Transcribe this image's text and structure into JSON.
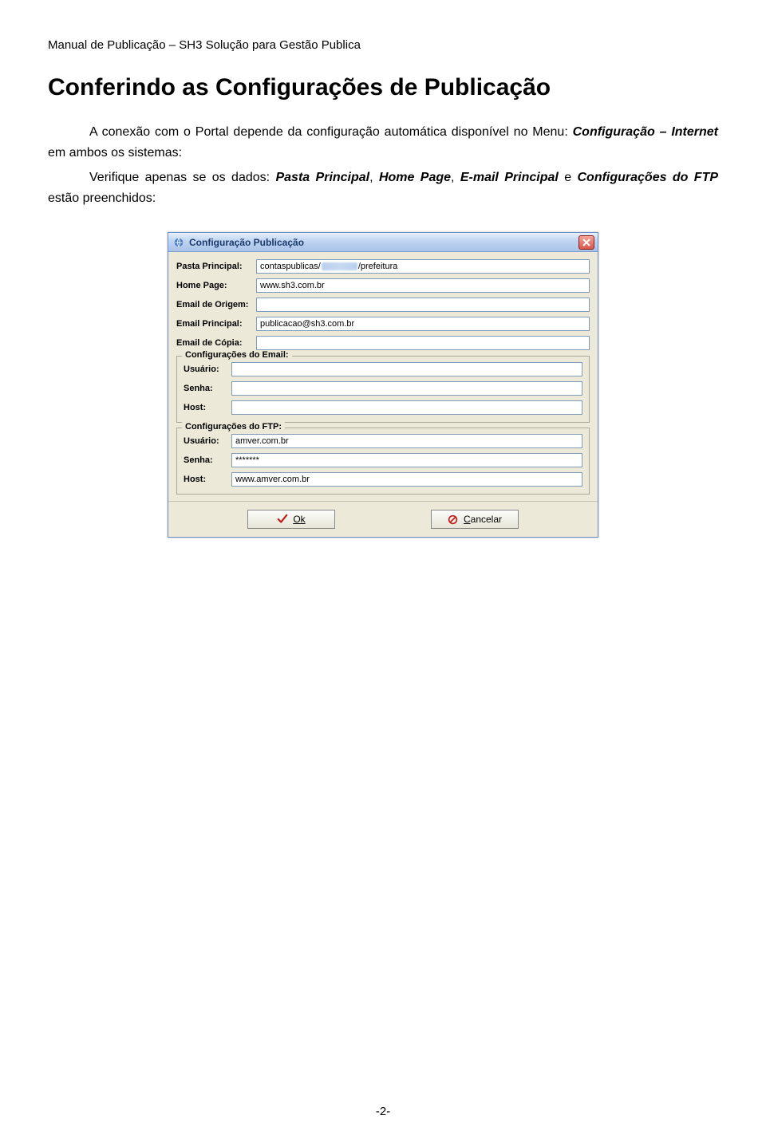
{
  "doc_header": "Manual de Publicação – SH3 Solução para Gestão Publica",
  "title": "Conferindo as Configurações de Publicação",
  "para1_pre": "A conexão com o Portal depende da configuração automática disponível no Menu: ",
  "para1_menu": "Configuração – Internet",
  "para1_post": " em ambos os sistemas:",
  "para2_pre": "Verifique apenas se os dados: ",
  "para2_f1": "Pasta Principal",
  "para2_f2": "Home Page",
  "para2_f3": "E-mail Principal",
  "para2_mid": " e ",
  "para2_f4": "Configurações do FTP",
  "para2_post": " estão preenchidos:",
  "dialog": {
    "title": "Configuração Publicação",
    "fields": {
      "pasta_label": "Pasta Principal:",
      "pasta_value_pre": "contaspublicas/",
      "pasta_value_post": "/prefeitura",
      "home_label": "Home Page:",
      "home_value": "www.sh3.com.br",
      "emailorig_label": "Email de Origem:",
      "emailorig_value": "",
      "emailprinc_label": "Email Principal:",
      "emailprinc_value": "publicacao@sh3.com.br",
      "emailcopia_label": "Email de Cópia:",
      "emailcopia_value": ""
    },
    "email_group": {
      "legend": "Configurações do Email:",
      "usuario_label": "Usuário:",
      "usuario_value": "",
      "senha_label": "Senha:",
      "senha_value": "",
      "host_label": "Host:",
      "host_value": ""
    },
    "ftp_group": {
      "legend": "Configurações do FTP:",
      "usuario_label": "Usuário:",
      "usuario_value": "amver.com.br",
      "senha_label": "Senha:",
      "senha_value": "*******",
      "host_label": "Host:",
      "host_value": "www.amver.com.br"
    },
    "ok_label": "Ok",
    "cancel_label": "Cancelar"
  },
  "page_num": "-2-"
}
